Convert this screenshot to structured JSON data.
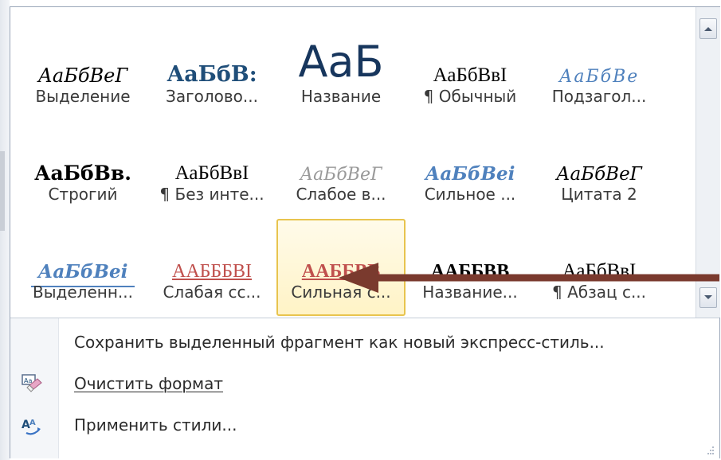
{
  "gallery": {
    "rows": [
      [
        {
          "preview": "АаБбВеГ",
          "label": "Выделение"
        },
        {
          "preview": "АаБбВ:",
          "label": "Заголово..."
        },
        {
          "preview": "АаБ",
          "label": "Название"
        },
        {
          "preview": "АаБбВвІ",
          "label": "¶ Обычный"
        },
        {
          "preview": "АаБбВе",
          "label": "Подзагол..."
        }
      ],
      [
        {
          "preview": "АаБбВв.",
          "label": "Строгий"
        },
        {
          "preview": "АаБбВвІ",
          "label": "¶ Без инте..."
        },
        {
          "preview": "АаБбВеГ",
          "label": "Слабое в..."
        },
        {
          "preview": "АаБбВеі",
          "label": "Сильное ..."
        },
        {
          "preview": "АаБбВеГ",
          "label": "Цитата 2"
        }
      ],
      [
        {
          "preview": "АаБбВеі",
          "label": "Выделенн..."
        },
        {
          "preview": "ААБББВІ",
          "label": "Слабая сс..."
        },
        {
          "preview": "ААББВВ",
          "label": "Сильная с..."
        },
        {
          "preview": "ААББВВ",
          "label": "Название..."
        },
        {
          "preview": "АаБбВвІ",
          "label": "¶ Абзац с..."
        }
      ]
    ],
    "selected_label": "Сильная с..."
  },
  "menu": {
    "save_label": "Сохранить выделенный фрагмент как новый экспресс-стиль...",
    "clear_label": "Очистить формат",
    "apply_label": "Применить стили..."
  },
  "icons": {
    "scroll_up": "scroll-up-icon",
    "scroll_down": "scroll-down-icon",
    "clear_format": "clear-format-icon",
    "apply_styles": "apply-styles-icon",
    "resize_grip": "resize-grip-icon"
  },
  "colors": {
    "selected_border": "#e8c44e",
    "arrow": "#7a3a2e",
    "heading_blue": "#1f4e79",
    "accent_blue": "#4f81bd",
    "reference_red": "#c0504d"
  }
}
